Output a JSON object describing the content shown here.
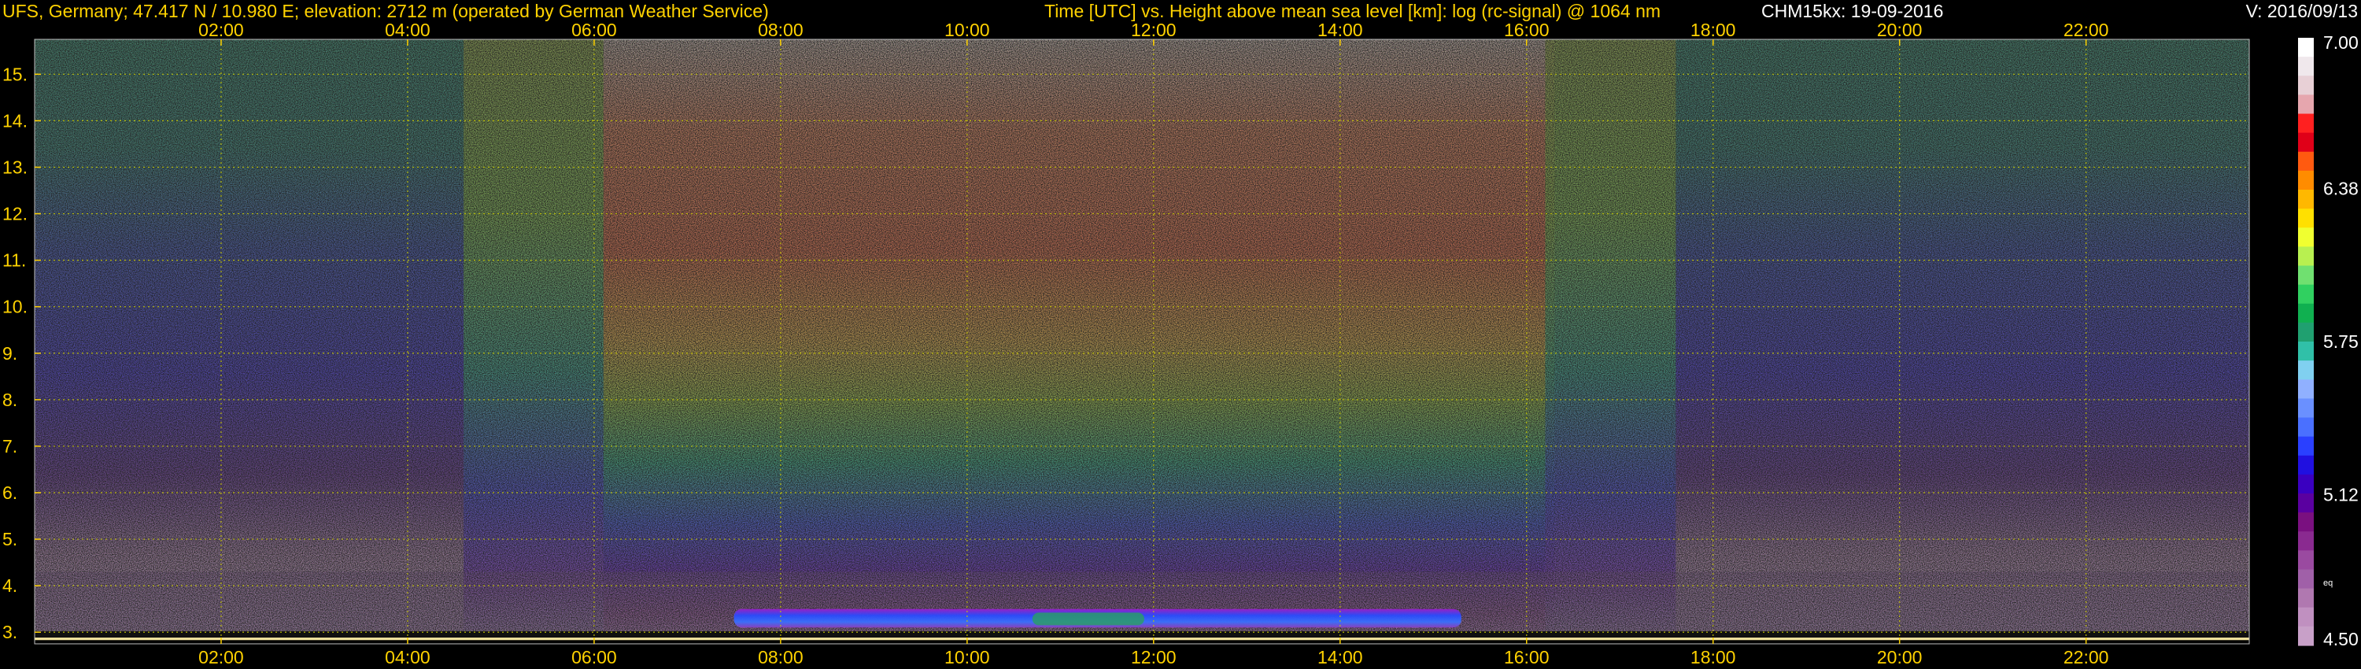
{
  "header": {
    "station": "UFS, Germany; 47.417 N / 10.980 E; elevation: 2712 m  (operated by German Weather Service)",
    "description": "Time [UTC] vs. Height above mean sea level [km]: log (rc-signal) @ 1064 nm",
    "instrument_date": "CHM15kx: 19-09-2016",
    "version": "V: 2016/09/13"
  },
  "colorbar": {
    "labels": [
      "7.00",
      "6.38",
      "5.75",
      "5.12",
      "4.50"
    ],
    "side_note": "eq"
  },
  "colors": {
    "header_text": "#ffd200",
    "tick_text": "#ffd200",
    "grid": "#c8c800",
    "background": "#000000"
  },
  "chart_data": {
    "type": "heatmap",
    "title": "Time [UTC] vs. Height above mean sea level [km]: log (rc-signal) @ 1064 nm",
    "xlabel": "Time [UTC]",
    "ylabel": "Height above mean sea level [km]",
    "x_ticks": [
      "02:00",
      "04:00",
      "06:00",
      "08:00",
      "10:00",
      "12:00",
      "14:00",
      "16:00",
      "18:00",
      "20:00",
      "22:00"
    ],
    "x_tick_hours": [
      2,
      4,
      6,
      8,
      10,
      12,
      14,
      16,
      18,
      20,
      22
    ],
    "xlim_hours": [
      0,
      23.75
    ],
    "y_ticks": [
      3,
      4,
      5,
      6,
      7,
      8,
      9,
      10,
      11,
      12,
      13,
      14,
      15
    ],
    "ylim_km": [
      2.75,
      15.75
    ],
    "colorscale": {
      "min": 4.5,
      "max": 7.0,
      "ticks": [
        7.0,
        6.38,
        5.75,
        5.12,
        4.5
      ]
    },
    "grid": true,
    "features": {
      "daytime_signal_hours": [
        5.2,
        17.2
      ],
      "aerosol_layer_km": [
        3.1,
        3.5
      ],
      "aerosol_layer_hours": [
        7.5,
        15.3
      ]
    }
  }
}
